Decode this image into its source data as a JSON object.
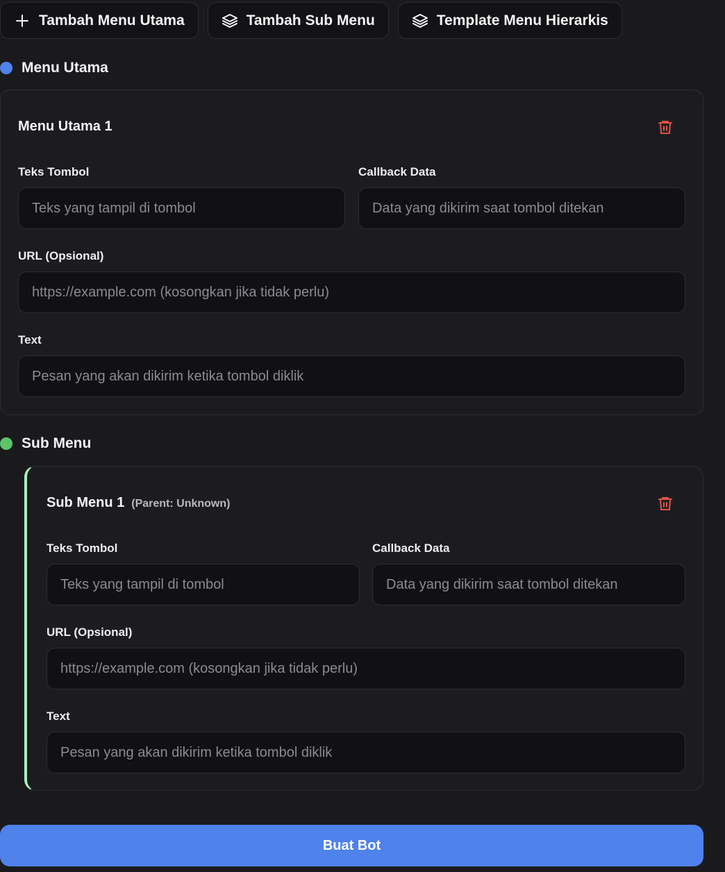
{
  "toolbar": {
    "add_main_label": "Tambah Menu Utama",
    "add_sub_label": "Tambah Sub Menu",
    "template_label": "Template Menu Hierarkis"
  },
  "main_section": {
    "title": "Menu Utama",
    "dot_color": "#4f82ea",
    "card": {
      "title": "Menu Utama 1",
      "button_text_label": "Teks Tombol",
      "button_text_placeholder": "Teks yang tampil di tombol",
      "callback_label": "Callback Data",
      "callback_placeholder": "Data yang dikirim saat tombol ditekan",
      "url_label": "URL (Opsional)",
      "url_placeholder": "https://example.com (kosongkan jika tidak perlu)",
      "text_label": "Text",
      "text_placeholder": "Pesan yang akan dikirim ketika tombol diklik"
    }
  },
  "sub_section": {
    "title": "Sub Menu",
    "dot_color": "#5cc46b",
    "accent_color": "#a6f2b8",
    "card": {
      "title": "Sub Menu 1",
      "parent_note": "(Parent: Unknown)",
      "button_text_label": "Teks Tombol",
      "button_text_placeholder": "Teks yang tampil di tombol",
      "callback_label": "Callback Data",
      "callback_placeholder": "Data yang dikirim saat tombol ditekan",
      "url_label": "URL (Opsional)",
      "url_placeholder": "https://example.com (kosongkan jika tidak perlu)",
      "text_label": "Text",
      "text_placeholder": "Pesan yang akan dikirim ketika tombol diklik"
    }
  },
  "icons": {
    "plus": "plus-icon",
    "layers": "layers-icon",
    "trash": "trash-icon"
  },
  "colors": {
    "delete": "#e05545",
    "submit": "#4f82ea"
  },
  "submit_label": "Buat Bot"
}
